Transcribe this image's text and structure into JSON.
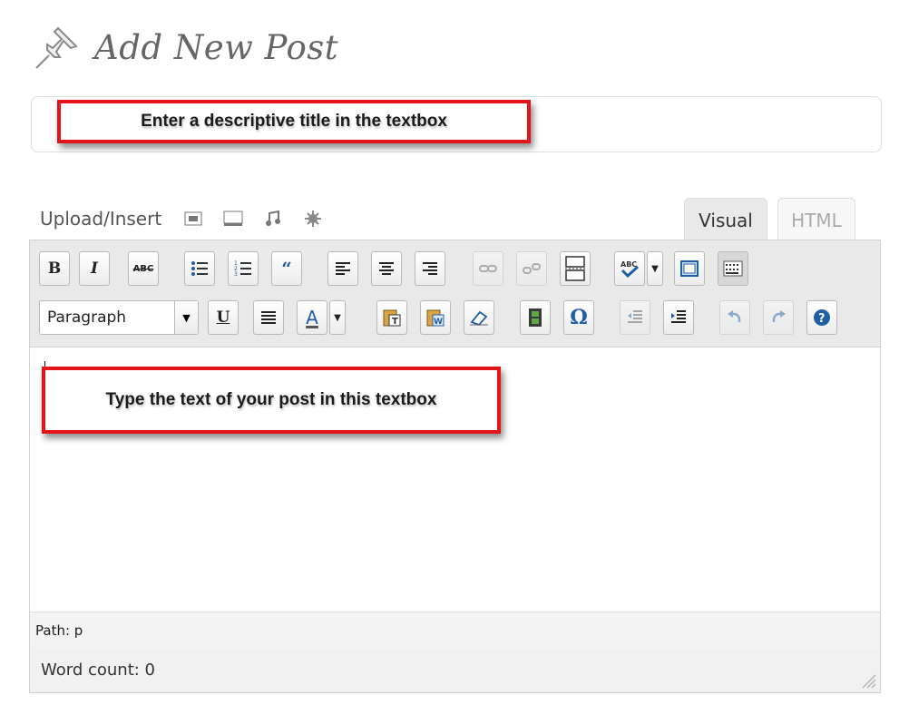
{
  "header": {
    "title": "Add New Post",
    "icon": "pushpin-icon"
  },
  "title_field": {
    "callout": "Enter a descriptive title in the textbox"
  },
  "media": {
    "label": "Upload/Insert",
    "icons": [
      "add-image-icon",
      "add-video-icon",
      "add-audio-icon",
      "add-media-icon"
    ]
  },
  "tabs": {
    "visual": "Visual",
    "html": "HTML"
  },
  "toolbar": {
    "row1": [
      "bold",
      "italic",
      "strikethrough",
      "unordered-list",
      "ordered-list",
      "blockquote",
      "align-left",
      "align-center",
      "align-right",
      "insert-link",
      "unlink",
      "insert-more",
      "spellcheck",
      "spellcheck-menu",
      "fullscreen",
      "kitchen-sink"
    ],
    "row2": [
      "format-select",
      "underline",
      "justify",
      "text-color",
      "text-color-menu",
      "paste-text",
      "paste-word",
      "remove-format",
      "insert-media",
      "special-character",
      "outdent",
      "indent",
      "undo",
      "redo",
      "help"
    ],
    "bold_label": "B",
    "italic_label": "I",
    "strike_label": "ABC",
    "underline_label": "U",
    "textcolor_label": "A",
    "omega_label": "Ω",
    "format_value": "Paragraph"
  },
  "editor": {
    "callout": "Type the text of your post in this textbox"
  },
  "footer": {
    "path": "Path: p",
    "word_count": "Word count: 0"
  }
}
